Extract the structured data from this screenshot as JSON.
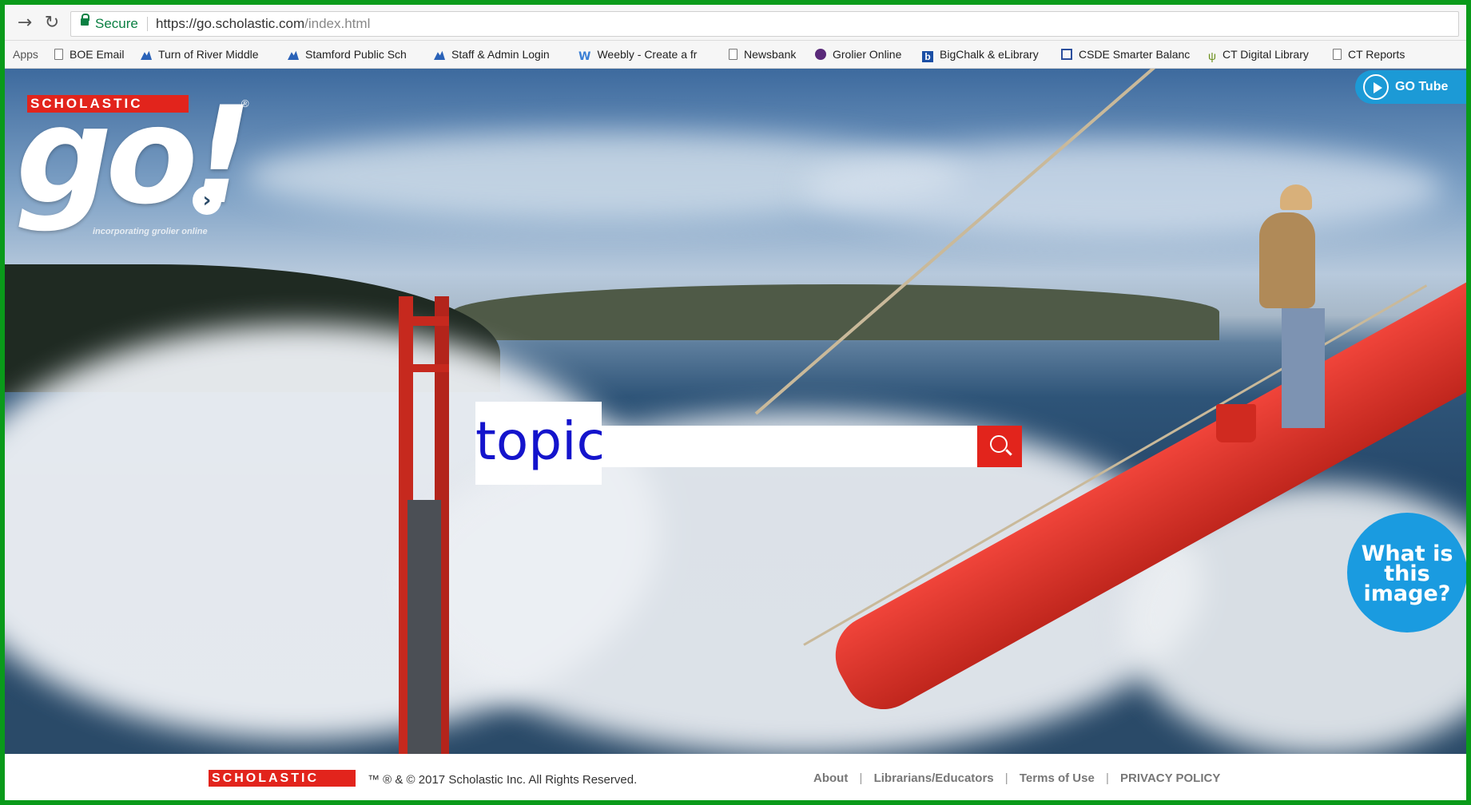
{
  "browser": {
    "secure_label": "Secure",
    "url_base": "https://go.scholastic.com",
    "url_path": "/index.html",
    "back_icon": "arrow-right-icon",
    "reload_icon": "reload-icon"
  },
  "bookmarks": {
    "apps": "Apps",
    "items": [
      "BOE Email",
      "Turn of River Middle",
      "Stamford Public Sch",
      "Staff & Admin Login",
      "Weebly - Create a fr",
      "Newsbank",
      "Grolier Online",
      "BigChalk & eLibrary",
      "CSDE Smarter Balanc",
      "CT Digital Library",
      "CT Reports"
    ]
  },
  "hero": {
    "brand": "SCHOLASTIC",
    "logo_text": "go!",
    "registered": "®",
    "tagline": "incorporating grolier online",
    "go_tube": "GO Tube",
    "search_label": "topic",
    "search_value": "",
    "what_image_line1": "What is",
    "what_image_line2": "this",
    "what_image_line3": "image?",
    "accent_color": "#e2241c",
    "blue_color": "#1a9be0"
  },
  "footer": {
    "brand": "SCHOLASTIC",
    "copyright": "™ ® & © 2017 Scholastic Inc. All Rights Reserved.",
    "links": [
      "About",
      "Librarians/Educators",
      "Terms of Use",
      "PRIVACY POLICY"
    ],
    "separator": "|"
  }
}
